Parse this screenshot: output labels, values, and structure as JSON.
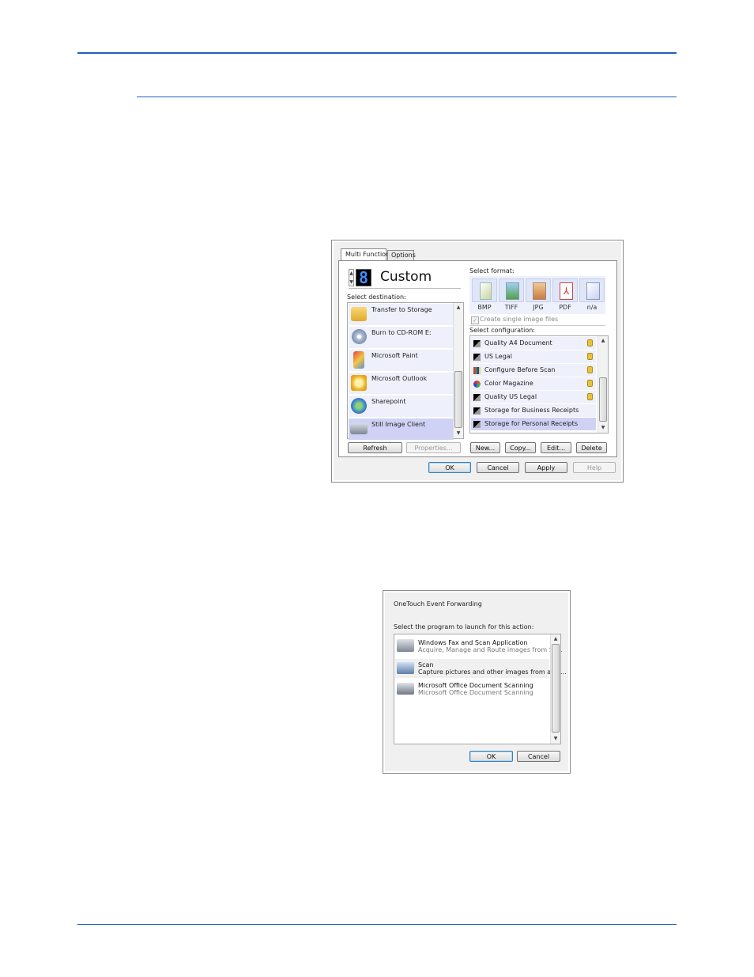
{
  "dialog1": {
    "tabs": [
      "Multi Function",
      "Options"
    ],
    "profile_name": "Custom",
    "select_destination_label": "Select destination:",
    "destinations": [
      {
        "label": "Transfer to Storage",
        "icon": "folder-storage-icon"
      },
      {
        "label": "Burn to CD-ROM  E:",
        "icon": "cd-burn-icon"
      },
      {
        "label": "Microsoft Paint",
        "icon": "paint-icon"
      },
      {
        "label": "Microsoft Outlook",
        "icon": "outlook-icon"
      },
      {
        "label": "Sharepoint",
        "icon": "sharepoint-icon"
      },
      {
        "label": "Still Image Client",
        "icon": "scanner-icon",
        "selected": true
      }
    ],
    "refresh_label": "Refresh",
    "properties_label": "Properties...",
    "select_format_label": "Select format:",
    "formats": [
      "BMP",
      "TIFF",
      "JPG",
      "PDF",
      "n/a"
    ],
    "create_single_label": "Create single image files",
    "select_configuration_label": "Select configuration:",
    "configurations": [
      {
        "label": "Quality A4 Document",
        "locked": true
      },
      {
        "label": "US Legal",
        "locked": true
      },
      {
        "label": "Configure Before Scan",
        "locked": true
      },
      {
        "label": "Color Magazine",
        "locked": true
      },
      {
        "label": "Quality US Legal",
        "locked": true
      },
      {
        "label": "Storage for Business Receipts",
        "locked": false
      },
      {
        "label": "Storage for Personal Receipts",
        "locked": false,
        "selected": true
      }
    ],
    "new_label": "New...",
    "copy_label": "Copy...",
    "edit_label": "Edit...",
    "delete_label": "Delete",
    "ok_label": "OK",
    "cancel_label": "Cancel",
    "apply_label": "Apply",
    "help_label": "Help"
  },
  "dialog2": {
    "title": "OneTouch Event Forwarding",
    "prompt": "Select the program to launch for this action:",
    "programs": [
      {
        "name": "Windows Fax and Scan Application",
        "desc": "Acquire, Manage and Route images from Sc..."
      },
      {
        "name": "Scan",
        "desc": "Capture pictures and other images from a ac...",
        "selected": true
      },
      {
        "name": "Microsoft Office Document Scanning",
        "desc": "Microsoft Office Document Scanning"
      }
    ],
    "ok_label": "OK",
    "cancel_label": "Cancel"
  }
}
